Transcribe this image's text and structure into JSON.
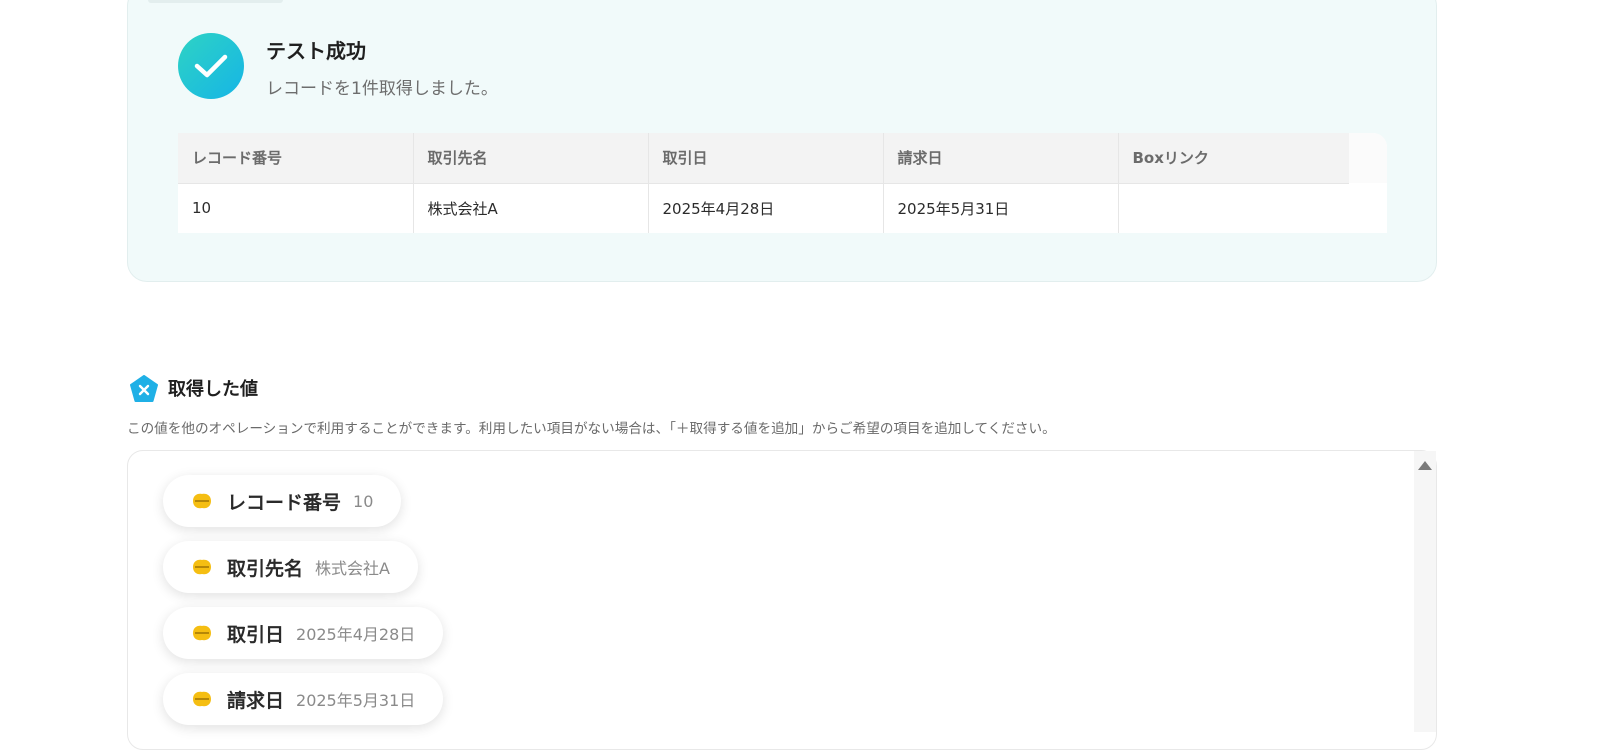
{
  "test_result": {
    "title": "テスト成功",
    "message": "レコードを1件取得しました。"
  },
  "record_table": {
    "columns": [
      "レコード番号",
      "取引先名",
      "取引日",
      "請求日",
      "Boxリンク"
    ],
    "rows": [
      [
        "10",
        "株式会社A",
        "2025年4月28日",
        "2025年5月31日",
        ""
      ]
    ]
  },
  "retrieved_values": {
    "title": "取得した値",
    "description": "この値を他のオペレーションで利用することができます。利用したい項目がない場合は、「＋取得する値を追加」からご希望の項目を追加してください。",
    "items": [
      {
        "label": "レコード番号",
        "value": "10"
      },
      {
        "label": "取引先名",
        "value": "株式会社A"
      },
      {
        "label": "取引日",
        "value": "2025年4月28日"
      },
      {
        "label": "請求日",
        "value": "2025年5月31日"
      }
    ]
  },
  "colors": {
    "success_gradient_start": "#2ed3c4",
    "success_gradient_end": "#16b5e6",
    "section_icon": "#1fb0e6",
    "service_icon": "#f5be12"
  },
  "icons": {
    "status": "check-icon",
    "section": "pentagon-x-icon",
    "service": "kintone-icon",
    "scroll": "scroll-up-arrow-icon"
  }
}
